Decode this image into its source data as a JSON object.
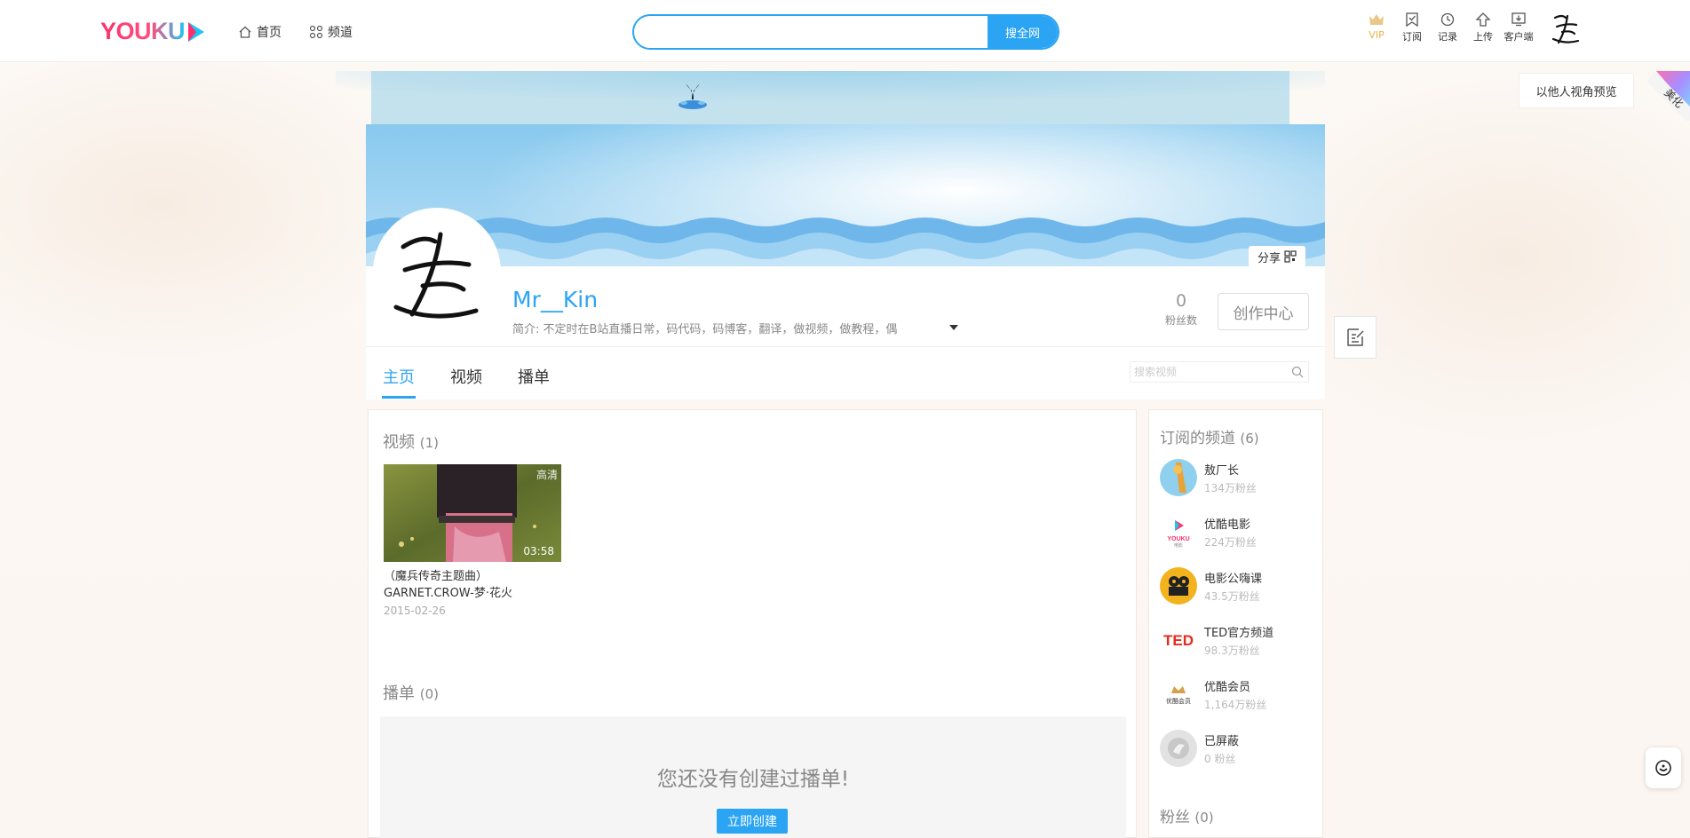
{
  "brand": {
    "logo": "YOUKU"
  },
  "nav": {
    "home": "首页",
    "channels": "频道"
  },
  "search": {
    "placeholder": "",
    "button": "搜全网"
  },
  "tools": [
    {
      "label": "VIP",
      "icon": "crown-icon"
    },
    {
      "label": "订阅",
      "icon": "bookmark-icon"
    },
    {
      "label": "记录",
      "icon": "clock-icon"
    },
    {
      "label": "上传",
      "icon": "upload-icon"
    },
    {
      "label": "客户端",
      "icon": "download-icon"
    }
  ],
  "preview": {
    "label": "以他人视角预览"
  },
  "ribbon": {
    "label": "美化"
  },
  "profile": {
    "username": "Mr__Kin",
    "bio": "简介: 不定时在B站直播日常，码代码，码博客，翻译，做视频，做教程，偶",
    "fans_count": "0",
    "fans_label": "粉丝数",
    "creator_button": "创作中心",
    "share": "分享"
  },
  "tabs": [
    {
      "label": "主页",
      "active": true
    },
    {
      "label": "视频",
      "active": false
    },
    {
      "label": "播单",
      "active": false
    }
  ],
  "video_search": {
    "placeholder": "搜索视频"
  },
  "videos_section": {
    "title": "视频",
    "count": "(1)",
    "items": [
      {
        "title": "（魔兵传奇主题曲）GARNET.CROW-梦·花火",
        "date": "2015-02-26",
        "duration": "03:58",
        "badge": "高清"
      }
    ]
  },
  "playlists_section": {
    "title": "播单",
    "count": "(0)",
    "empty_text": "您还没有创建过播单!",
    "create_button": "立即创建"
  },
  "subscriptions": {
    "title": "订阅的频道",
    "count": "(6)",
    "items": [
      {
        "name": "敖厂长",
        "fans": "134万粉丝"
      },
      {
        "name": "优酷电影",
        "fans": "224万粉丝"
      },
      {
        "name": "电影公嗨课",
        "fans": "43.5万粉丝"
      },
      {
        "name": "TED官方频道",
        "fans": "98.3万粉丝"
      },
      {
        "name": "优酷会员",
        "fans": "1,164万粉丝"
      },
      {
        "name": "已屏蔽",
        "fans": "0 粉丝"
      }
    ]
  },
  "followers": {
    "title": "粉丝",
    "count": "(0)"
  },
  "colors": {
    "accent": "#2ba4f3",
    "vip": "#e8b44c",
    "brand_pink": "#ff2e6c"
  }
}
